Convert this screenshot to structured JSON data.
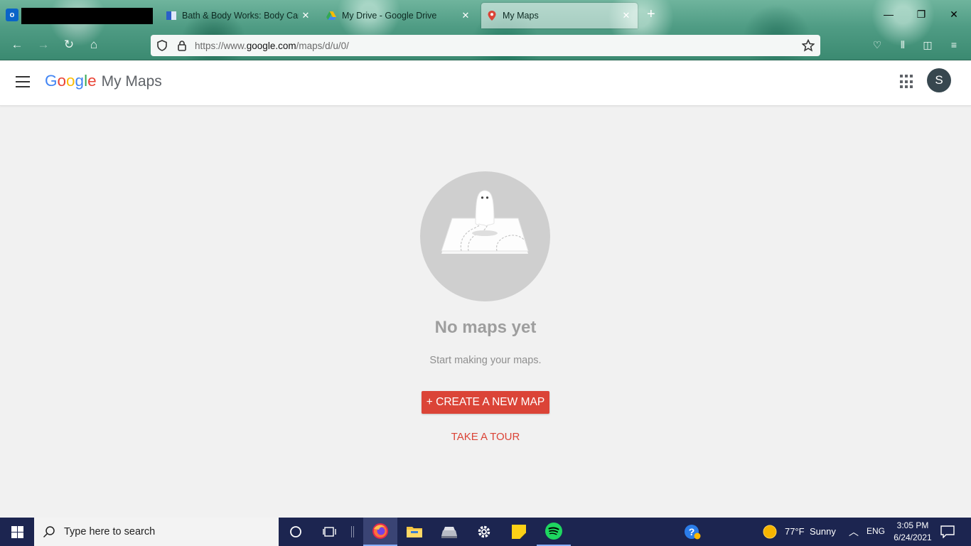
{
  "browser": {
    "tabs": [
      {
        "title": "Bath & Body Works: Body Care",
        "close": "✕"
      },
      {
        "title": "My Drive - Google Drive",
        "close": "✕"
      },
      {
        "title": "My Maps",
        "close": "✕",
        "active": true
      }
    ],
    "new_tab": "+",
    "window_controls": {
      "minimize": "—",
      "maximize": "❐",
      "close": "✕"
    },
    "url_prefix": "https://www.",
    "url_domain": "google.com",
    "url_path": "/maps/d/u/0/"
  },
  "app": {
    "brand_letters": [
      "G",
      "o",
      "o",
      "g",
      "l",
      "e"
    ],
    "brand_colors": [
      "#4285f4",
      "#ea4335",
      "#fbbc05",
      "#4285f4",
      "#34a853",
      "#ea4335"
    ],
    "product": "My Maps",
    "avatar_initial": "S"
  },
  "empty_state": {
    "title": "No maps yet",
    "subtitle": "Start making your maps.",
    "create_button": "+ CREATE A NEW MAP",
    "tour_link": "TAKE A TOUR"
  },
  "accent_color": "#db4437",
  "taskbar": {
    "search_placeholder": "Type here to search",
    "weather_temp": "77°F",
    "weather_desc": "Sunny",
    "language": "ENG",
    "time": "3:05 PM",
    "date": "6/24/2021"
  }
}
